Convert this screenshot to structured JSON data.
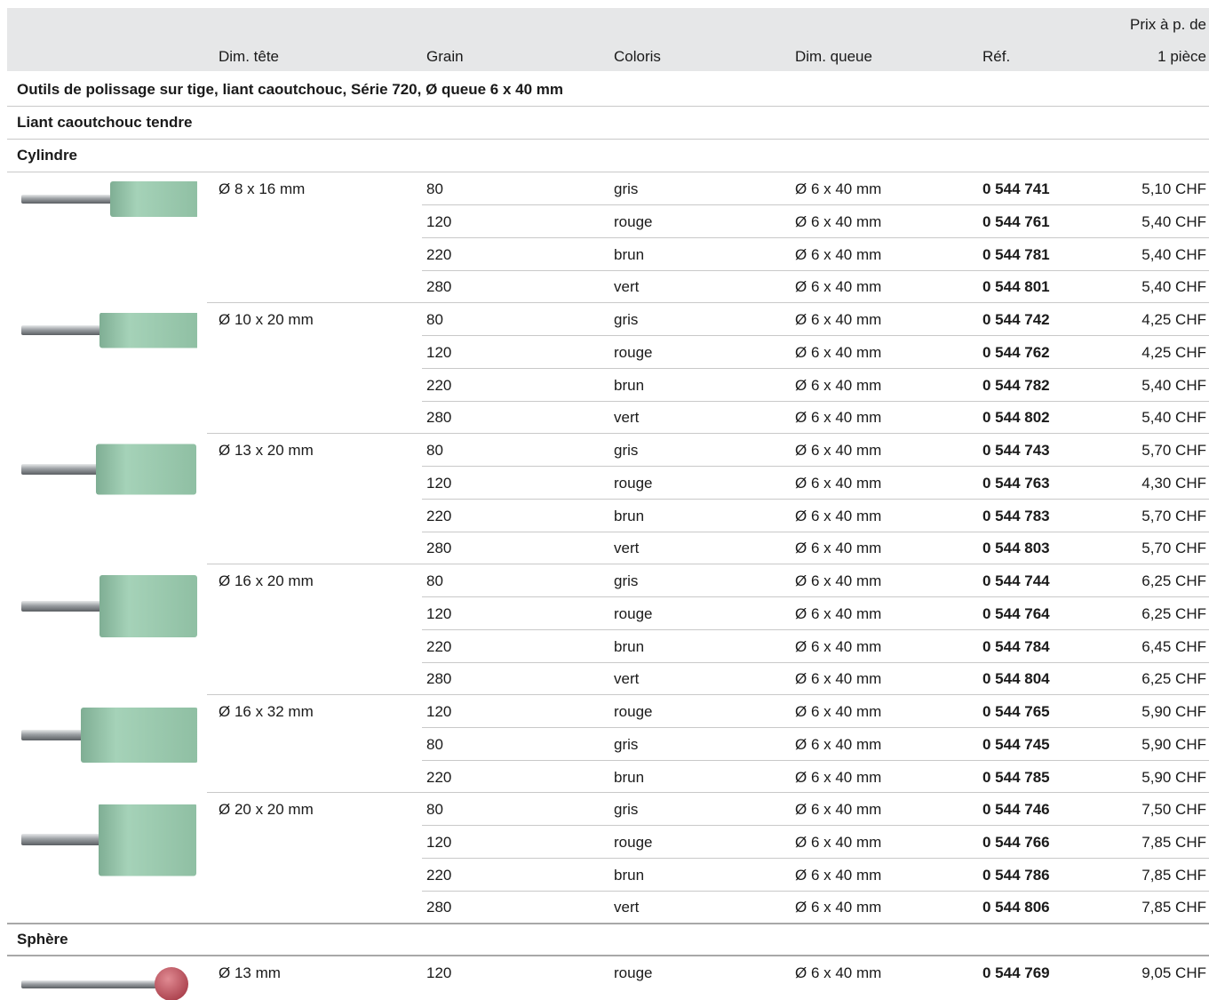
{
  "header": {
    "dim_tete": "Dim. tête",
    "grain": "Grain",
    "coloris": "Coloris",
    "dim_queue": "Dim. queue",
    "ref": "Réf.",
    "price_line1": "Prix à p. de",
    "price_line2": "1 pièce"
  },
  "sections": {
    "series_title": "Outils de polissage sur tige, liant caoutchouc, Série 720, Ø queue 6 x 40 mm",
    "subtitle": "Liant caoutchouc tendre",
    "cylinder": "Cylindre",
    "sphere": "Sphère"
  },
  "groups": [
    {
      "dim": "Ø 8 x 16 mm",
      "rows": [
        {
          "grain": "80",
          "color": "gris",
          "queue": "Ø 6 x 40 mm",
          "ref": "0 544 741",
          "price": "5,10 CHF"
        },
        {
          "grain": "120",
          "color": "rouge",
          "queue": "Ø 6 x 40 mm",
          "ref": "0 544 761",
          "price": "5,40 CHF"
        },
        {
          "grain": "220",
          "color": "brun",
          "queue": "Ø 6 x 40 mm",
          "ref": "0 544 781",
          "price": "5,40 CHF"
        },
        {
          "grain": "280",
          "color": "vert",
          "queue": "Ø 6 x 40 mm",
          "ref": "0 544 801",
          "price": "5,40 CHF"
        }
      ]
    },
    {
      "dim": "Ø 10 x 20 mm",
      "rows": [
        {
          "grain": "80",
          "color": "gris",
          "queue": "Ø 6 x 40 mm",
          "ref": "0 544 742",
          "price": "4,25 CHF"
        },
        {
          "grain": "120",
          "color": "rouge",
          "queue": "Ø 6 x 40 mm",
          "ref": "0 544 762",
          "price": "4,25 CHF"
        },
        {
          "grain": "220",
          "color": "brun",
          "queue": "Ø 6 x 40 mm",
          "ref": "0 544 782",
          "price": "5,40 CHF"
        },
        {
          "grain": "280",
          "color": "vert",
          "queue": "Ø 6 x 40 mm",
          "ref": "0 544 802",
          "price": "5,40 CHF"
        }
      ]
    },
    {
      "dim": "Ø 13 x 20 mm",
      "rows": [
        {
          "grain": "80",
          "color": "gris",
          "queue": "Ø 6 x 40 mm",
          "ref": "0 544 743",
          "price": "5,70 CHF"
        },
        {
          "grain": "120",
          "color": "rouge",
          "queue": "Ø 6 x 40 mm",
          "ref": "0 544 763",
          "price": "4,30 CHF"
        },
        {
          "grain": "220",
          "color": "brun",
          "queue": "Ø 6 x 40 mm",
          "ref": "0 544 783",
          "price": "5,70 CHF"
        },
        {
          "grain": "280",
          "color": "vert",
          "queue": "Ø 6 x 40 mm",
          "ref": "0 544 803",
          "price": "5,70 CHF"
        }
      ]
    },
    {
      "dim": "Ø 16 x 20 mm",
      "rows": [
        {
          "grain": "80",
          "color": "gris",
          "queue": "Ø 6 x 40 mm",
          "ref": "0 544 744",
          "price": "6,25 CHF"
        },
        {
          "grain": "120",
          "color": "rouge",
          "queue": "Ø 6 x 40 mm",
          "ref": "0 544 764",
          "price": "6,25 CHF"
        },
        {
          "grain": "220",
          "color": "brun",
          "queue": "Ø 6 x 40 mm",
          "ref": "0 544 784",
          "price": "6,45 CHF"
        },
        {
          "grain": "280",
          "color": "vert",
          "queue": "Ø 6 x 40 mm",
          "ref": "0 544 804",
          "price": "6,25 CHF"
        }
      ]
    },
    {
      "dim": "Ø 16 x 32 mm",
      "rows": [
        {
          "grain": "120",
          "color": "rouge",
          "queue": "Ø 6 x 40 mm",
          "ref": "0 544 765",
          "price": "5,90 CHF"
        },
        {
          "grain": "80",
          "color": "gris",
          "queue": "Ø 6 x 40 mm",
          "ref": "0 544 745",
          "price": "5,90 CHF"
        },
        {
          "grain": "220",
          "color": "brun",
          "queue": "Ø 6 x 40 mm",
          "ref": "0 544 785",
          "price": "5,90 CHF"
        }
      ]
    },
    {
      "dim": "Ø 20 x 20 mm",
      "rows": [
        {
          "grain": "80",
          "color": "gris",
          "queue": "Ø 6 x 40 mm",
          "ref": "0 544 746",
          "price": "7,50 CHF"
        },
        {
          "grain": "120",
          "color": "rouge",
          "queue": "Ø 6 x 40 mm",
          "ref": "0 544 766",
          "price": "7,85 CHF"
        },
        {
          "grain": "220",
          "color": "brun",
          "queue": "Ø 6 x 40 mm",
          "ref": "0 544 786",
          "price": "7,85 CHF"
        },
        {
          "grain": "280",
          "color": "vert",
          "queue": "Ø 6 x 40 mm",
          "ref": "0 544 806",
          "price": "7,85 CHF"
        }
      ]
    }
  ],
  "sphere_group": {
    "dim": "Ø 13 mm",
    "rows": [
      {
        "grain": "120",
        "color": "rouge",
        "queue": "Ø 6 x 40 mm",
        "ref": "0 544 769",
        "price": "9,05 CHF"
      }
    ]
  },
  "colors": {
    "header_bg": "#e6e7e8",
    "rubber_green": "#9ccbb0",
    "rubber_red": "#c25560",
    "steel": "#b8bcbf"
  }
}
